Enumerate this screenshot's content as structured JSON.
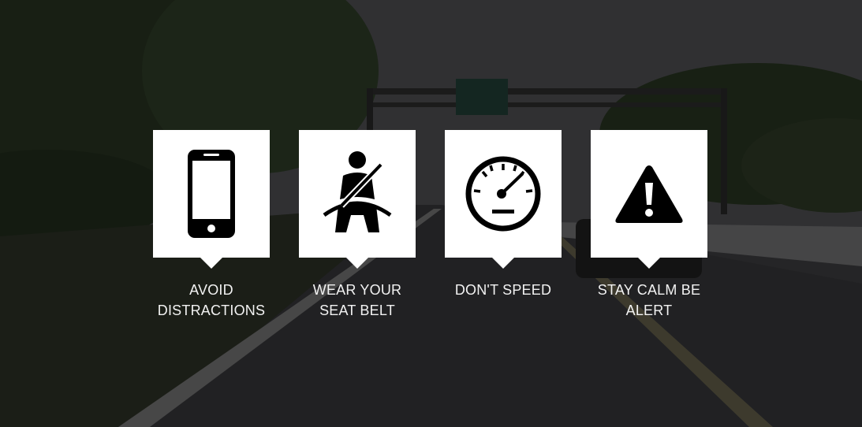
{
  "tips": [
    {
      "label": "AVOID DISTRACTIONS",
      "icon": "smartphone-icon"
    },
    {
      "label": "WEAR YOUR SEAT BELT",
      "icon": "seat-belt-icon"
    },
    {
      "label": "DON'T SPEED",
      "icon": "speedometer-icon"
    },
    {
      "label": "STAY CALM BE ALERT",
      "icon": "warning-icon"
    }
  ],
  "colors": {
    "card": "#ffffff",
    "icon": "#000000",
    "text": "#f2f2f2"
  }
}
